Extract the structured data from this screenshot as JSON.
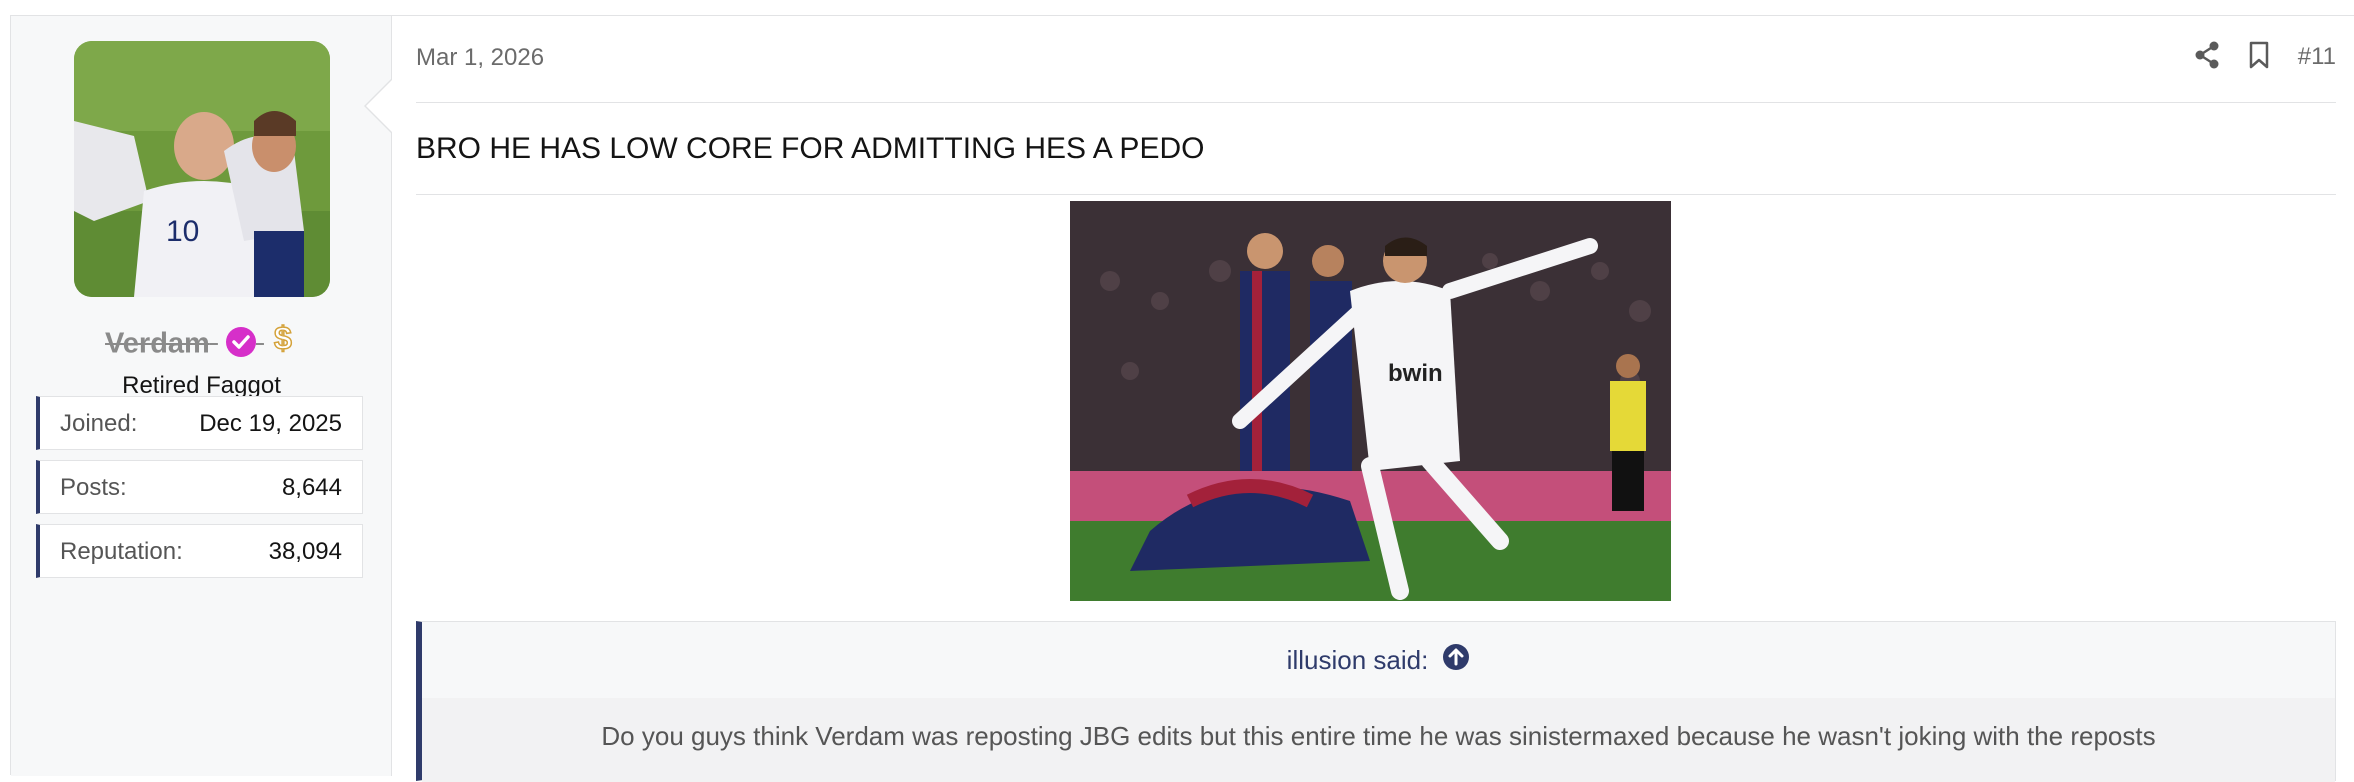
{
  "post": {
    "author": {
      "username": "Verdam",
      "title": "Retired Faggot",
      "badge_icon": "verified-check-icon",
      "extra_icon": "dollar-icon",
      "stats": [
        {
          "label": "Joined:",
          "value": "Dec 19, 2025"
        },
        {
          "label": "Posts:",
          "value": "8,644"
        },
        {
          "label": "Reputation:",
          "value": "38,094"
        }
      ]
    },
    "date": "Mar 1, 2026",
    "post_number": "#11",
    "message": "BRO HE HAS LOW CORE FOR ADMITTING HES A PEDO",
    "quote": {
      "attribution": "illusion said:",
      "text": "Do you guys think Verdam was reposting JBG edits but this entire time he was sinistermaxed because he wasn't joking with the reposts"
    }
  },
  "colors": {
    "accent": "#2f3b6b",
    "verified": "#d62fc9",
    "meta_text": "#6b6b6b",
    "sidebar_bg": "#f7f8f9"
  }
}
